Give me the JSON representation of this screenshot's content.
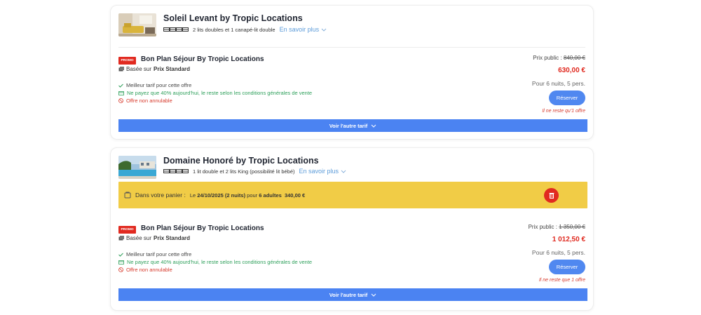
{
  "properties": [
    {
      "title": "Soleil Levant by Tropic Locations",
      "beds": "2 lits doubles et 1 canapé-lit double",
      "more_label": "En savoir plus",
      "offer": {
        "badge": "PROMO",
        "title": "Bon Plan Séjour By Tropic Locations",
        "based_prefix": "Basée sur",
        "based_rate": "Prix Standard",
        "features": [
          "Meilleur tarif pour cette offre",
          "Ne payez que 40% aujourd'hui, le reste selon les conditions générales de vente",
          "Offre non annulable"
        ],
        "public_price_label": "Prix public :",
        "public_price": "840,00 €",
        "price": "630,00 €",
        "stay": "Pour 6 nuits, 5 pers.",
        "reserve_label": "Réserver",
        "remaining": "Il ne reste qu'1 offre"
      },
      "other_rate_label": "Voir l'autre tarif"
    },
    {
      "title": "Domaine Honoré by Tropic Locations",
      "beds": "1 lit double et 2 lits King (possibilité lit bébé)",
      "more_label": "En savoir plus",
      "cart": {
        "label": "Dans votre panier :",
        "date_prefix": "Le",
        "date": "24/10/2025",
        "nights": "(2 nuits)",
        "for_label": "pour",
        "guests": "6 adultes",
        "amount": "340,00 €"
      },
      "offer": {
        "badge": "PROMO",
        "title": "Bon Plan Séjour By Tropic Locations",
        "based_prefix": "Basée sur",
        "based_rate": "Prix Standard",
        "features": [
          "Meilleur tarif pour cette offre",
          "Ne payez que 40% aujourd'hui, le reste selon les conditions générales de vente",
          "Offre non annulable"
        ],
        "public_price_label": "Prix public :",
        "public_price": "1 350,00 €",
        "price": "1 012,50 €",
        "stay": "Pour 6 nuits, 5 pers.",
        "reserve_label": "Réserver",
        "remaining": "Il ne reste que 1 offre"
      },
      "other_rate_label": "Voir l'autre tarif"
    }
  ],
  "colors": {
    "accent_blue": "#4b83f2",
    "promo_red": "#e12a20",
    "price_red": "#e0281e",
    "cart_yellow": "#f1cc46",
    "success_green": "#2d9f5a"
  },
  "icons": [
    "bed-icon",
    "chevron-down-icon",
    "cart-icon",
    "trash-icon",
    "tag-icon",
    "check-icon",
    "card-icon",
    "ban-icon"
  ]
}
